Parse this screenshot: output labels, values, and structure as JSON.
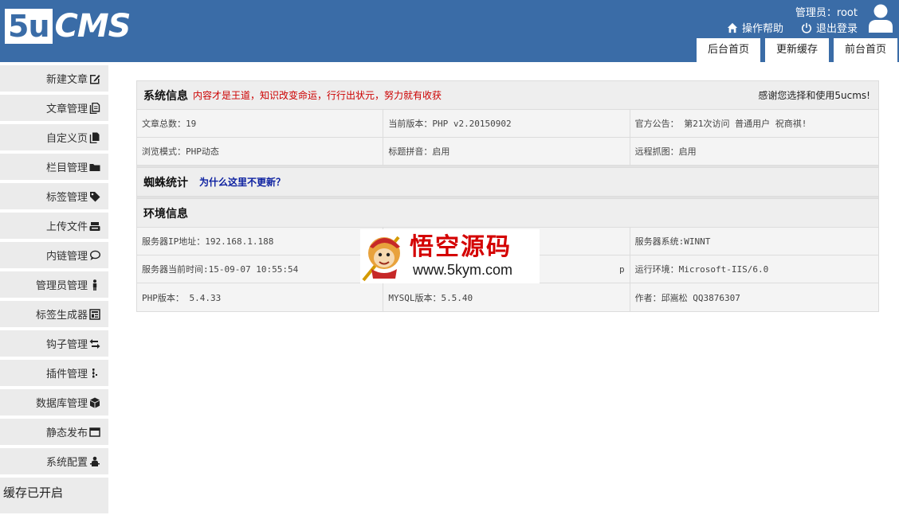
{
  "header": {
    "logo_box": "5u",
    "logo_text": "CMS",
    "admin_label": "管理员：root",
    "help_link": "操作帮助",
    "logout_link": "退出登录",
    "tabs": [
      "后台首页",
      "更新缓存",
      "前台首页"
    ],
    "bg_color": "#3a6ca7"
  },
  "sidebar": {
    "items": [
      {
        "label": "新建文章",
        "icon": "edit-icon"
      },
      {
        "label": "文章管理",
        "icon": "documents-icon"
      },
      {
        "label": "自定义页",
        "icon": "pages-icon"
      },
      {
        "label": "栏目管理",
        "icon": "folder-icon"
      },
      {
        "label": "标签管理",
        "icon": "tag-icon"
      },
      {
        "label": "上传文件",
        "icon": "upload-icon"
      },
      {
        "label": "内链管理",
        "icon": "comment-icon"
      },
      {
        "label": "管理员管理",
        "icon": "user-icon"
      },
      {
        "label": "标签生成器",
        "icon": "layout-icon"
      },
      {
        "label": "钩子管理",
        "icon": "exchange-icon"
      },
      {
        "label": "插件管理",
        "icon": "plugin-icon"
      },
      {
        "label": "数据库管理",
        "icon": "database-icon"
      },
      {
        "label": "静态发布",
        "icon": "window-icon"
      },
      {
        "label": "系统配置",
        "icon": "settings-icon"
      }
    ],
    "cache_status": "缓存已开启"
  },
  "system_info": {
    "title": "系统信息",
    "motto": "内容才是王道，知识改变命运，行行出状元，努力就有收获",
    "thanks": "感谢您选择和使用5ucms!",
    "rows": [
      [
        "文章总数：19",
        "当前版本：PHP v2.20150902",
        "官方公告： 第21次访问 普通用户 祝商祺!"
      ],
      [
        "浏览模式：PHP动态",
        "标题拼音：启用",
        "远程抓图：启用"
      ]
    ]
  },
  "spider": {
    "title": "蜘蛛统计",
    "link": "为什么这里不更新？"
  },
  "environment": {
    "title": "环境信息",
    "rows": [
      [
        "服务器IP地址：192.168.1.188",
        "",
        "服务器系统:WINNT"
      ],
      [
        "服务器当前时间:15-09-07 10:55:54",
        "p",
        "运行环境：Microsoft-IIS/6.0"
      ],
      [
        "PHP版本： 5.4.33",
        "MYSQL版本：5.5.40",
        "作者：邱嵩松 QQ3876307"
      ]
    ]
  },
  "watermark": {
    "text": "悟空源码",
    "url": "www.5kym.com"
  }
}
